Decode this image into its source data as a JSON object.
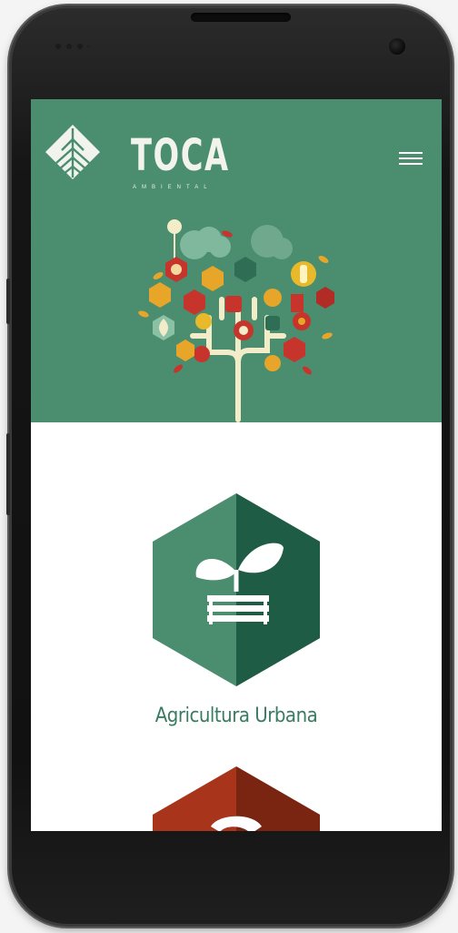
{
  "brand": {
    "name": "TOCA",
    "tagline": "AMBIENTAL",
    "primary_color": "#4a8d6f",
    "dark_green": "#1f5c46",
    "accent_red": "#a8351b"
  },
  "header": {
    "menu_icon": "hamburger-menu-icon",
    "illustration": "eco-tree-illustration"
  },
  "cards": [
    {
      "label": "Agricultura Urbana",
      "icon": "sprout-planter-icon"
    }
  ]
}
